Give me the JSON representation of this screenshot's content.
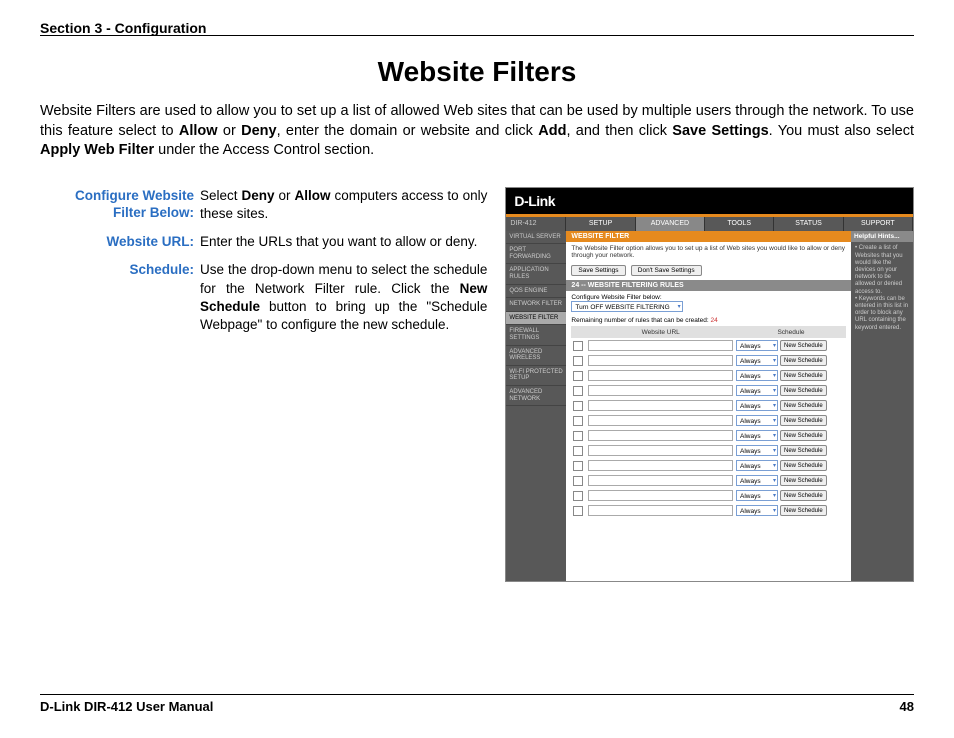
{
  "header": {
    "section": "Section 3 - Configuration"
  },
  "title": "Website Filters",
  "intro": {
    "t1": "Website Filters are used to allow you to set up a list of allowed Web sites that can be used by multiple users through the network. To use this feature select to ",
    "b1": "Allow",
    "t2": " or ",
    "b2": "Deny",
    "t3": ", enter the domain or website and click ",
    "b3": "Add",
    "t4": ", and then click ",
    "b4": "Save Settings",
    "t5": ". You must also select ",
    "b5": "Apply Web Filter",
    "t6": " under the Access Control section."
  },
  "defs": [
    {
      "label": "Configure Website Filter Below:",
      "pre": "Select ",
      "b1": "Deny",
      "mid": " or ",
      "b2": "Allow",
      "post": " computers access to only these sites."
    },
    {
      "label": "Website URL:",
      "text": "Enter the URLs that you want to allow or deny."
    },
    {
      "label": "Schedule:",
      "pre": "Use the drop-down menu to select the schedule for the Network Filter rule. Click the ",
      "b1": "New Schedule",
      "post": " button to bring up the \"Schedule Webpage\" to configure the new schedule."
    }
  ],
  "router": {
    "brand": "D-Link",
    "model": "DIR-412",
    "tabs": [
      "SETUP",
      "ADVANCED",
      "TOOLS",
      "STATUS",
      "SUPPORT"
    ],
    "active_tab": 1,
    "sidebar": [
      "VIRTUAL SERVER",
      "PORT FORWARDING",
      "APPLICATION RULES",
      "QOS ENGINE",
      "NETWORK FILTER",
      "WEBSITE FILTER",
      "FIREWALL SETTINGS",
      "ADVANCED WIRELESS",
      "WI-FI PROTECTED SETUP",
      "ADVANCED NETWORK"
    ],
    "active_side": 5,
    "section_head": "WEBSITE FILTER",
    "desc": "The Website Filter option allows you to set up a list of Web sites you would like to allow or deny through your network.",
    "save_btn": "Save Settings",
    "dont_btn": "Don't Save Settings",
    "rules_head": "24 -- WEBSITE FILTERING RULES",
    "config_label": "Configure Website Filter below:",
    "filter_mode": "Turn OFF WEBSITE FILTERING",
    "remain_label": "Remaining number of rules that can be created:",
    "remain_num": "24",
    "th_url": "Website URL",
    "th_sch": "Schedule",
    "row_always": "Always",
    "row_newsch": "New Schedule",
    "row_count": 12,
    "help_head": "Helpful Hints...",
    "help_text": "• Create a list of Websites that you would like the devices on your network to be allowed or denied access to.\n• Keywords can be entered in this list in order to block any URL containing the keyword entered."
  },
  "footer": {
    "left": "D-Link DIR-412 User Manual",
    "right": "48"
  }
}
